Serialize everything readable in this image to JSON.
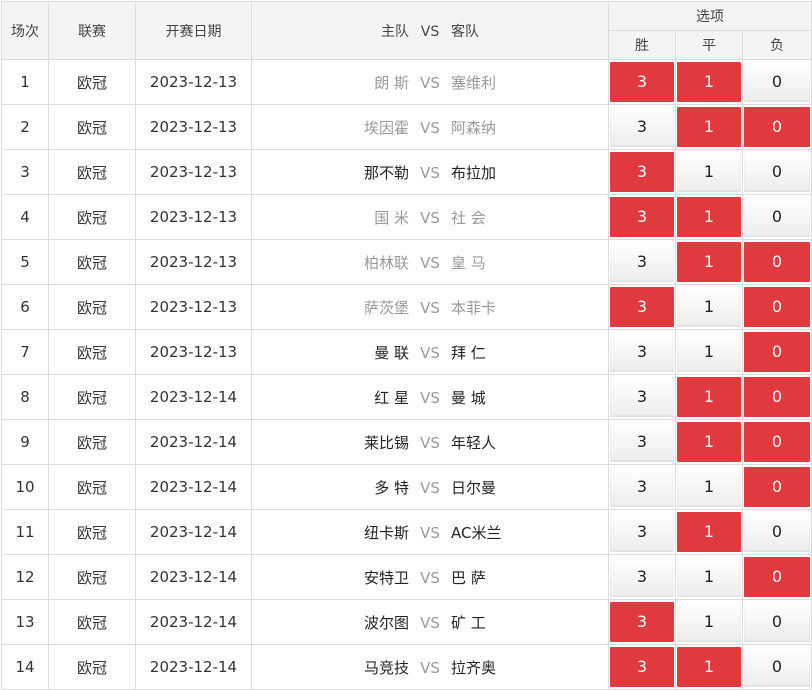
{
  "headers": {
    "round": "场次",
    "league": "联赛",
    "date": "开赛日期",
    "home": "主队",
    "vs": "VS",
    "away": "客队",
    "options": "选项",
    "win": "胜",
    "draw": "平",
    "lose": "负"
  },
  "colors": {
    "selected": "#e0393e",
    "muted_team": "#999999"
  },
  "rows": [
    {
      "n": "1",
      "league": "欧冠",
      "date": "2023-12-13",
      "home": "朗 斯",
      "away": "塞维利",
      "teams_muted": true,
      "win": "3",
      "draw": "1",
      "lose": "0",
      "sel": [
        true,
        true,
        false
      ]
    },
    {
      "n": "2",
      "league": "欧冠",
      "date": "2023-12-13",
      "home": "埃因霍",
      "away": "阿森纳",
      "teams_muted": true,
      "win": "3",
      "draw": "1",
      "lose": "0",
      "sel": [
        false,
        true,
        true
      ]
    },
    {
      "n": "3",
      "league": "欧冠",
      "date": "2023-12-13",
      "home": "那不勒",
      "away": "布拉加",
      "teams_muted": false,
      "win": "3",
      "draw": "1",
      "lose": "0",
      "sel": [
        true,
        false,
        false
      ]
    },
    {
      "n": "4",
      "league": "欧冠",
      "date": "2023-12-13",
      "home": "国 米",
      "away": "社 会",
      "teams_muted": true,
      "win": "3",
      "draw": "1",
      "lose": "0",
      "sel": [
        true,
        true,
        false
      ]
    },
    {
      "n": "5",
      "league": "欧冠",
      "date": "2023-12-13",
      "home": "柏林联",
      "away": "皇 马",
      "teams_muted": true,
      "win": "3",
      "draw": "1",
      "lose": "0",
      "sel": [
        false,
        true,
        true
      ]
    },
    {
      "n": "6",
      "league": "欧冠",
      "date": "2023-12-13",
      "home": "萨茨堡",
      "away": "本菲卡",
      "teams_muted": true,
      "win": "3",
      "draw": "1",
      "lose": "0",
      "sel": [
        true,
        false,
        true
      ]
    },
    {
      "n": "7",
      "league": "欧冠",
      "date": "2023-12-13",
      "home": "曼 联",
      "away": "拜 仁",
      "teams_muted": false,
      "win": "3",
      "draw": "1",
      "lose": "0",
      "sel": [
        false,
        false,
        true
      ]
    },
    {
      "n": "8",
      "league": "欧冠",
      "date": "2023-12-14",
      "home": "红 星",
      "away": "曼 城",
      "teams_muted": false,
      "win": "3",
      "draw": "1",
      "lose": "0",
      "sel": [
        false,
        true,
        true
      ]
    },
    {
      "n": "9",
      "league": "欧冠",
      "date": "2023-12-14",
      "home": "莱比锡",
      "away": "年轻人",
      "teams_muted": false,
      "win": "3",
      "draw": "1",
      "lose": "0",
      "sel": [
        false,
        true,
        true
      ]
    },
    {
      "n": "10",
      "league": "欧冠",
      "date": "2023-12-14",
      "home": "多 特",
      "away": "日尔曼",
      "teams_muted": false,
      "win": "3",
      "draw": "1",
      "lose": "0",
      "sel": [
        false,
        false,
        true
      ]
    },
    {
      "n": "11",
      "league": "欧冠",
      "date": "2023-12-14",
      "home": "纽卡斯",
      "away": "AC米兰",
      "teams_muted": false,
      "win": "3",
      "draw": "1",
      "lose": "0",
      "sel": [
        false,
        true,
        false
      ]
    },
    {
      "n": "12",
      "league": "欧冠",
      "date": "2023-12-14",
      "home": "安特卫",
      "away": "巴 萨",
      "teams_muted": false,
      "win": "3",
      "draw": "1",
      "lose": "0",
      "sel": [
        false,
        false,
        true
      ]
    },
    {
      "n": "13",
      "league": "欧冠",
      "date": "2023-12-14",
      "home": "波尔图",
      "away": "矿 工",
      "teams_muted": false,
      "win": "3",
      "draw": "1",
      "lose": "0",
      "sel": [
        true,
        false,
        false
      ]
    },
    {
      "n": "14",
      "league": "欧冠",
      "date": "2023-12-14",
      "home": "马竞技",
      "away": "拉齐奥",
      "teams_muted": false,
      "win": "3",
      "draw": "1",
      "lose": "0",
      "sel": [
        true,
        true,
        false
      ]
    }
  ]
}
